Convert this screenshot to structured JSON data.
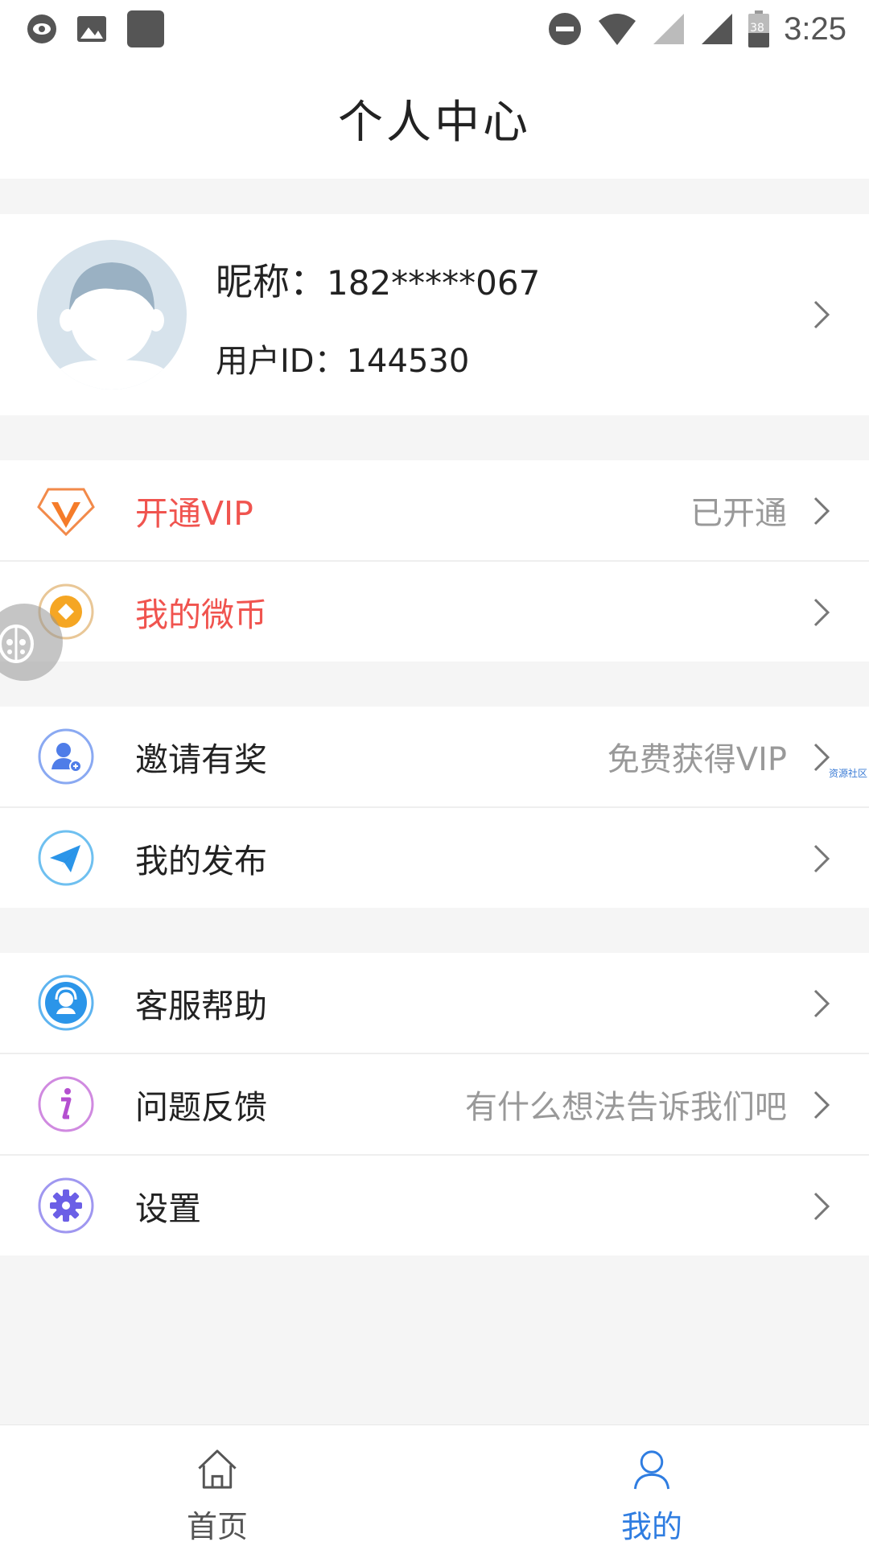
{
  "status_bar": {
    "time": "3:25",
    "battery": "38",
    "icons": [
      "eye-icon",
      "image-icon",
      "app-icon",
      "dnd-icon",
      "wifi-icon",
      "signal-icon",
      "signal-icon",
      "battery-icon"
    ]
  },
  "header": {
    "title": "个人中心"
  },
  "profile": {
    "nickname_label": "昵称：",
    "nickname_value": "182*****067",
    "uid_label": "用户ID：",
    "uid_value": "144530"
  },
  "groups": [
    {
      "items": [
        {
          "icon": "vip-diamond-icon",
          "label": "开通VIP",
          "hint": "已开通",
          "accent": "#f0544f"
        },
        {
          "icon": "coin-icon",
          "label": "我的微币",
          "hint": "",
          "accent": "#f0544f"
        }
      ]
    },
    {
      "items": [
        {
          "icon": "invite-user-icon",
          "label": "邀请有奖",
          "hint": "免费获得VIP"
        },
        {
          "icon": "paper-plane-icon",
          "label": "我的发布",
          "hint": ""
        }
      ]
    },
    {
      "items": [
        {
          "icon": "customer-service-icon",
          "label": "客服帮助",
          "hint": ""
        },
        {
          "icon": "info-icon",
          "label": "问题反馈",
          "hint": "有什么想法告诉我们吧"
        },
        {
          "icon": "gear-icon",
          "label": "设置",
          "hint": ""
        }
      ]
    }
  ],
  "watermark": "资源社区",
  "bottom_nav": {
    "tabs": [
      {
        "icon": "home-icon",
        "label": "首页",
        "active": false
      },
      {
        "icon": "user-icon",
        "label": "我的",
        "active": true
      }
    ],
    "active_color": "#2f7de1"
  },
  "colors": {
    "accent_red": "#f0544f",
    "accent_blue": "#2f7de1",
    "background": "#f5f5f5"
  }
}
